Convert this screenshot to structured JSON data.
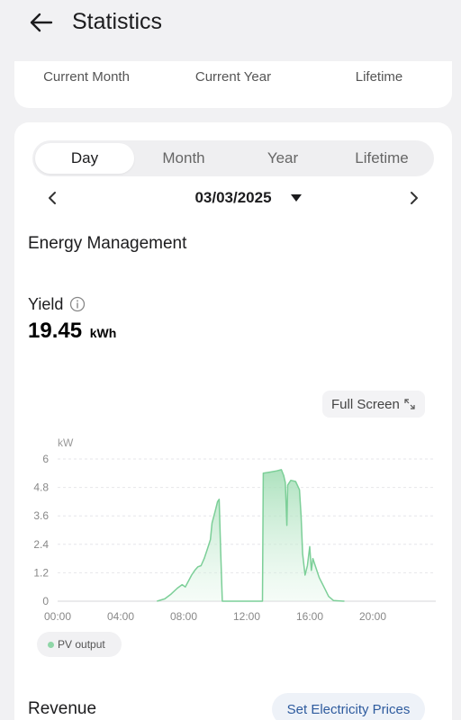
{
  "header": {
    "title": "Statistics",
    "back_icon": "arrow-left-icon"
  },
  "summary": {
    "labels": [
      "Current Month",
      "Current Year",
      "Lifetime"
    ]
  },
  "tabs": [
    {
      "label": "Day",
      "active": true
    },
    {
      "label": "Month",
      "active": false
    },
    {
      "label": "Year",
      "active": false
    },
    {
      "label": "Lifetime",
      "active": false
    }
  ],
  "date": {
    "value": "03/03/2025"
  },
  "energy": {
    "title": "Energy Management"
  },
  "yield": {
    "label": "Yield",
    "value": "19.45",
    "unit": "kWh"
  },
  "fullscreen": {
    "label": "Full Screen"
  },
  "legend": {
    "label": "PV output",
    "color": "#8fd6a7"
  },
  "revenue": {
    "title": "Revenue",
    "set_prices_label": "Set Electricity Prices"
  },
  "chart_data": {
    "type": "area",
    "ylabel": "kW",
    "yticks": [
      "0",
      "1.2",
      "2.4",
      "3.6",
      "4.8",
      "6"
    ],
    "xticks": [
      "00:00",
      "04:00",
      "08:00",
      "12:00",
      "16:00",
      "20:00"
    ],
    "ylim": [
      0,
      6
    ],
    "xlim_hours": [
      0,
      24
    ],
    "grid": true,
    "series": [
      {
        "name": "PV output",
        "color": "#7ccf98",
        "points": [
          [
            6.3,
            0
          ],
          [
            6.8,
            0.1
          ],
          [
            7.2,
            0.3
          ],
          [
            7.6,
            0.55
          ],
          [
            7.9,
            0.7
          ],
          [
            8.1,
            0.6
          ],
          [
            8.3,
            0.85
          ],
          [
            8.5,
            1.1
          ],
          [
            8.7,
            1.3
          ],
          [
            8.9,
            1.45
          ],
          [
            9.1,
            1.5
          ],
          [
            9.3,
            1.8
          ],
          [
            9.5,
            2.2
          ],
          [
            9.7,
            2.6
          ],
          [
            9.8,
            3.3
          ],
          [
            10.0,
            3.8
          ],
          [
            10.15,
            4.2
          ],
          [
            10.25,
            4.3
          ],
          [
            10.35,
            2.1
          ],
          [
            10.45,
            0
          ],
          [
            13.0,
            0
          ],
          [
            13.05,
            5.4
          ],
          [
            13.5,
            5.45
          ],
          [
            13.9,
            5.5
          ],
          [
            14.2,
            5.55
          ],
          [
            14.35,
            5.3
          ],
          [
            14.45,
            5.0
          ],
          [
            14.55,
            3.2
          ],
          [
            14.6,
            4.9
          ],
          [
            14.8,
            5.1
          ],
          [
            15.1,
            5.05
          ],
          [
            15.35,
            4.7
          ],
          [
            15.45,
            3.6
          ],
          [
            15.55,
            2.0
          ],
          [
            15.7,
            1.1
          ],
          [
            15.85,
            1.5
          ],
          [
            16.0,
            2.3
          ],
          [
            16.1,
            1.3
          ],
          [
            16.2,
            1.8
          ],
          [
            16.35,
            1.5
          ],
          [
            16.6,
            1.0
          ],
          [
            16.9,
            0.6
          ],
          [
            17.2,
            0.2
          ],
          [
            17.5,
            0.03
          ],
          [
            18.2,
            0
          ]
        ]
      }
    ]
  }
}
